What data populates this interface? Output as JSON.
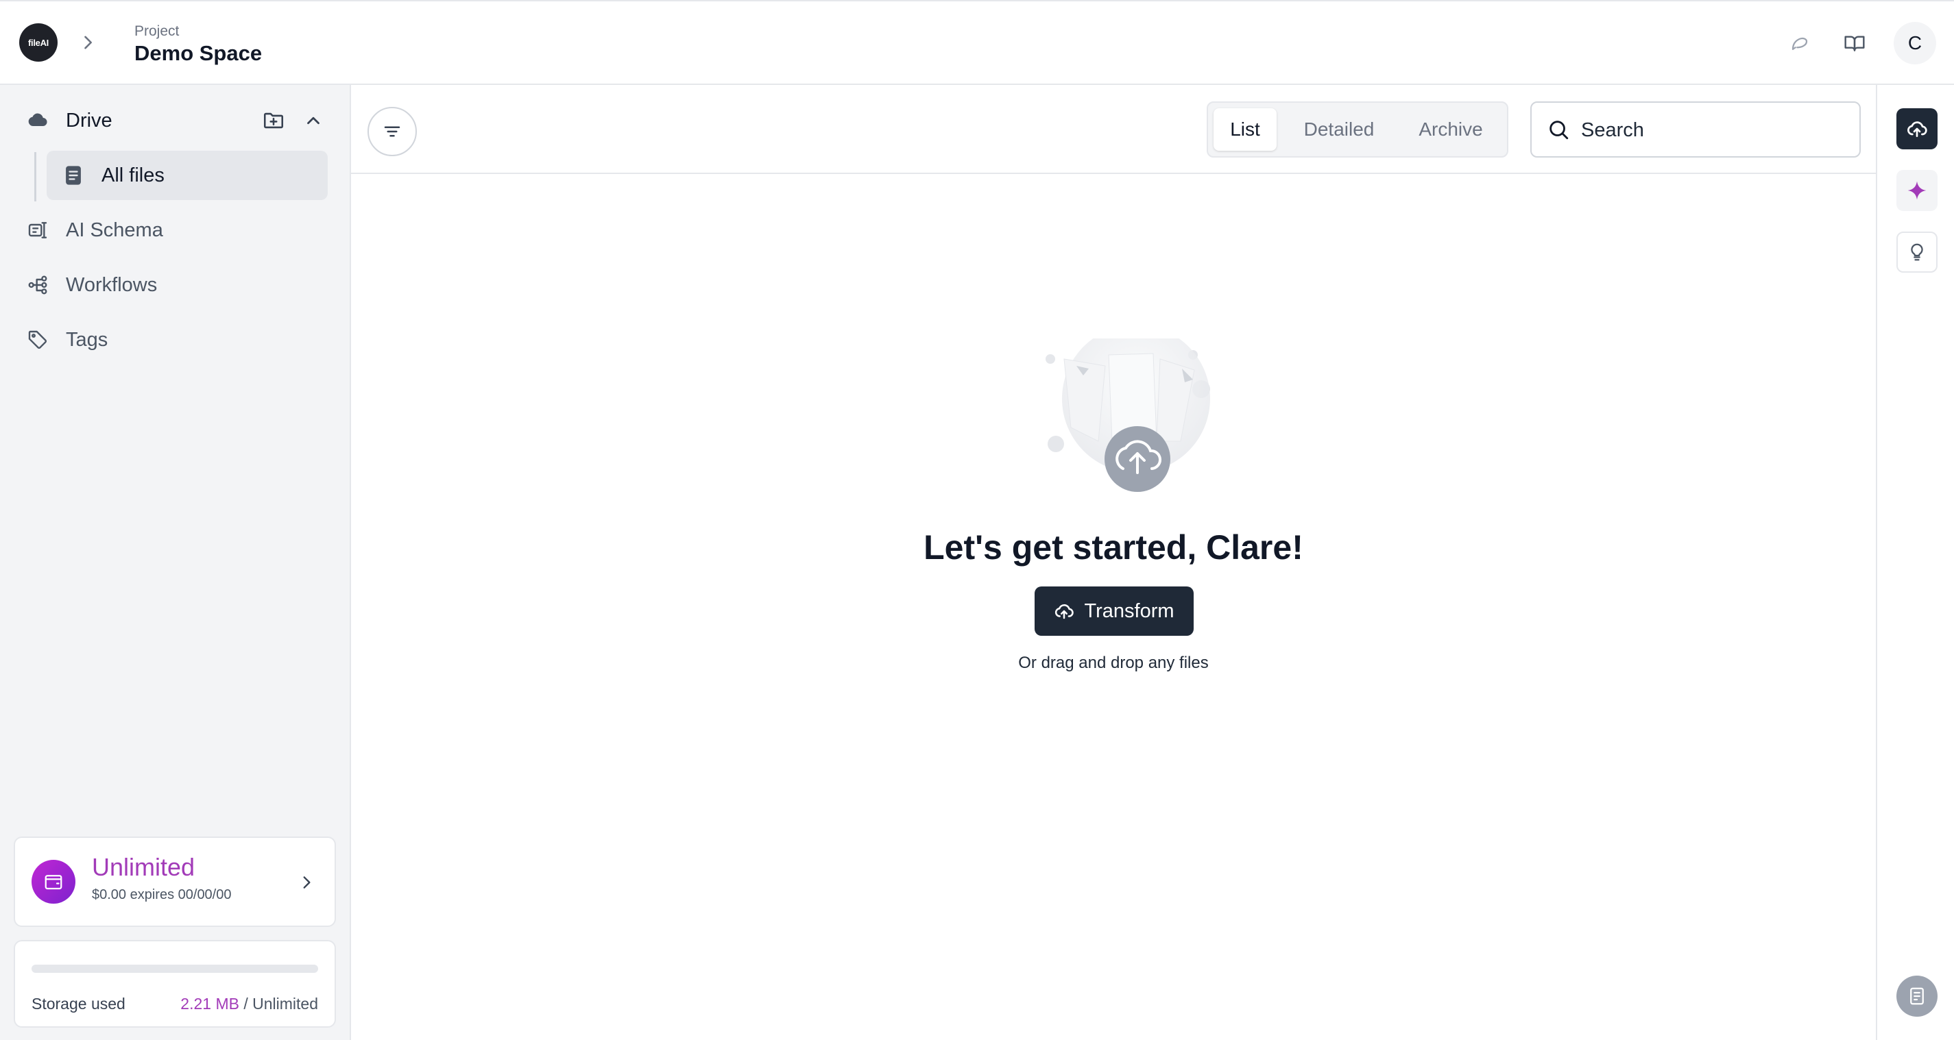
{
  "header": {
    "logo_text": "fileAI",
    "project_label": "Project",
    "project_name": "Demo Space",
    "avatar_initial": "C",
    "icons": [
      "chevron-right-icon",
      "chat-icon",
      "book-icon"
    ]
  },
  "sidebar": {
    "drive_label": "Drive",
    "items": [
      {
        "label": "All files",
        "icon": "document-icon"
      },
      {
        "label": "AI Schema",
        "icon": "schema-icon"
      },
      {
        "label": "Workflows",
        "icon": "workflow-icon"
      },
      {
        "label": "Tags",
        "icon": "tag-icon"
      }
    ],
    "plan": {
      "title": "Unlimited",
      "subtitle": "$0.00 expires 00/00/00"
    },
    "storage": {
      "label": "Storage used",
      "used": "2.21 MB",
      "separator": " / ",
      "total": "Unlimited",
      "fill_fraction": 0.0
    }
  },
  "toolbar": {
    "tabs": [
      "List",
      "Detailed",
      "Archive"
    ],
    "active_tab": "List",
    "search_placeholder": "Search"
  },
  "empty_state": {
    "title": "Let's get started, Clare!",
    "button_label": "Transform",
    "subtitle": "Or drag and drop any files"
  },
  "colors": {
    "accent": "#a23bb8",
    "dark": "#1f2937",
    "sidebar_bg": "#f3f4f6"
  }
}
